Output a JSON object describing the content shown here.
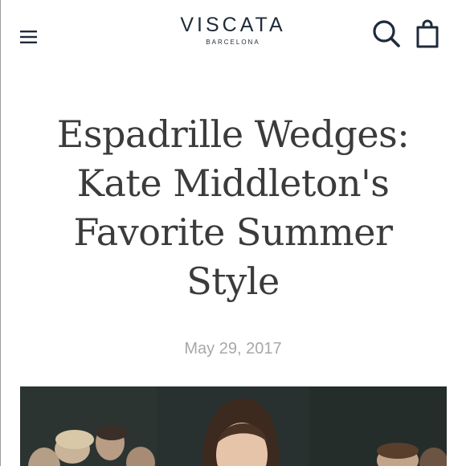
{
  "header": {
    "brand_name": "VISCATA",
    "brand_sub": "BARCELONA",
    "menu_icon": "hamburger-menu-icon",
    "search_icon": "search-icon",
    "bag_icon": "shopping-bag-icon"
  },
  "article": {
    "title_lines": [
      "Espadrille Wedges:",
      "Kate Middleton's",
      "Favorite Summer",
      "Style"
    ],
    "date": "May 29, 2017"
  },
  "colors": {
    "brand": "#1f2b3a",
    "title": "#3b3b3b",
    "date": "#a8a8a8",
    "background": "#ffffff"
  }
}
